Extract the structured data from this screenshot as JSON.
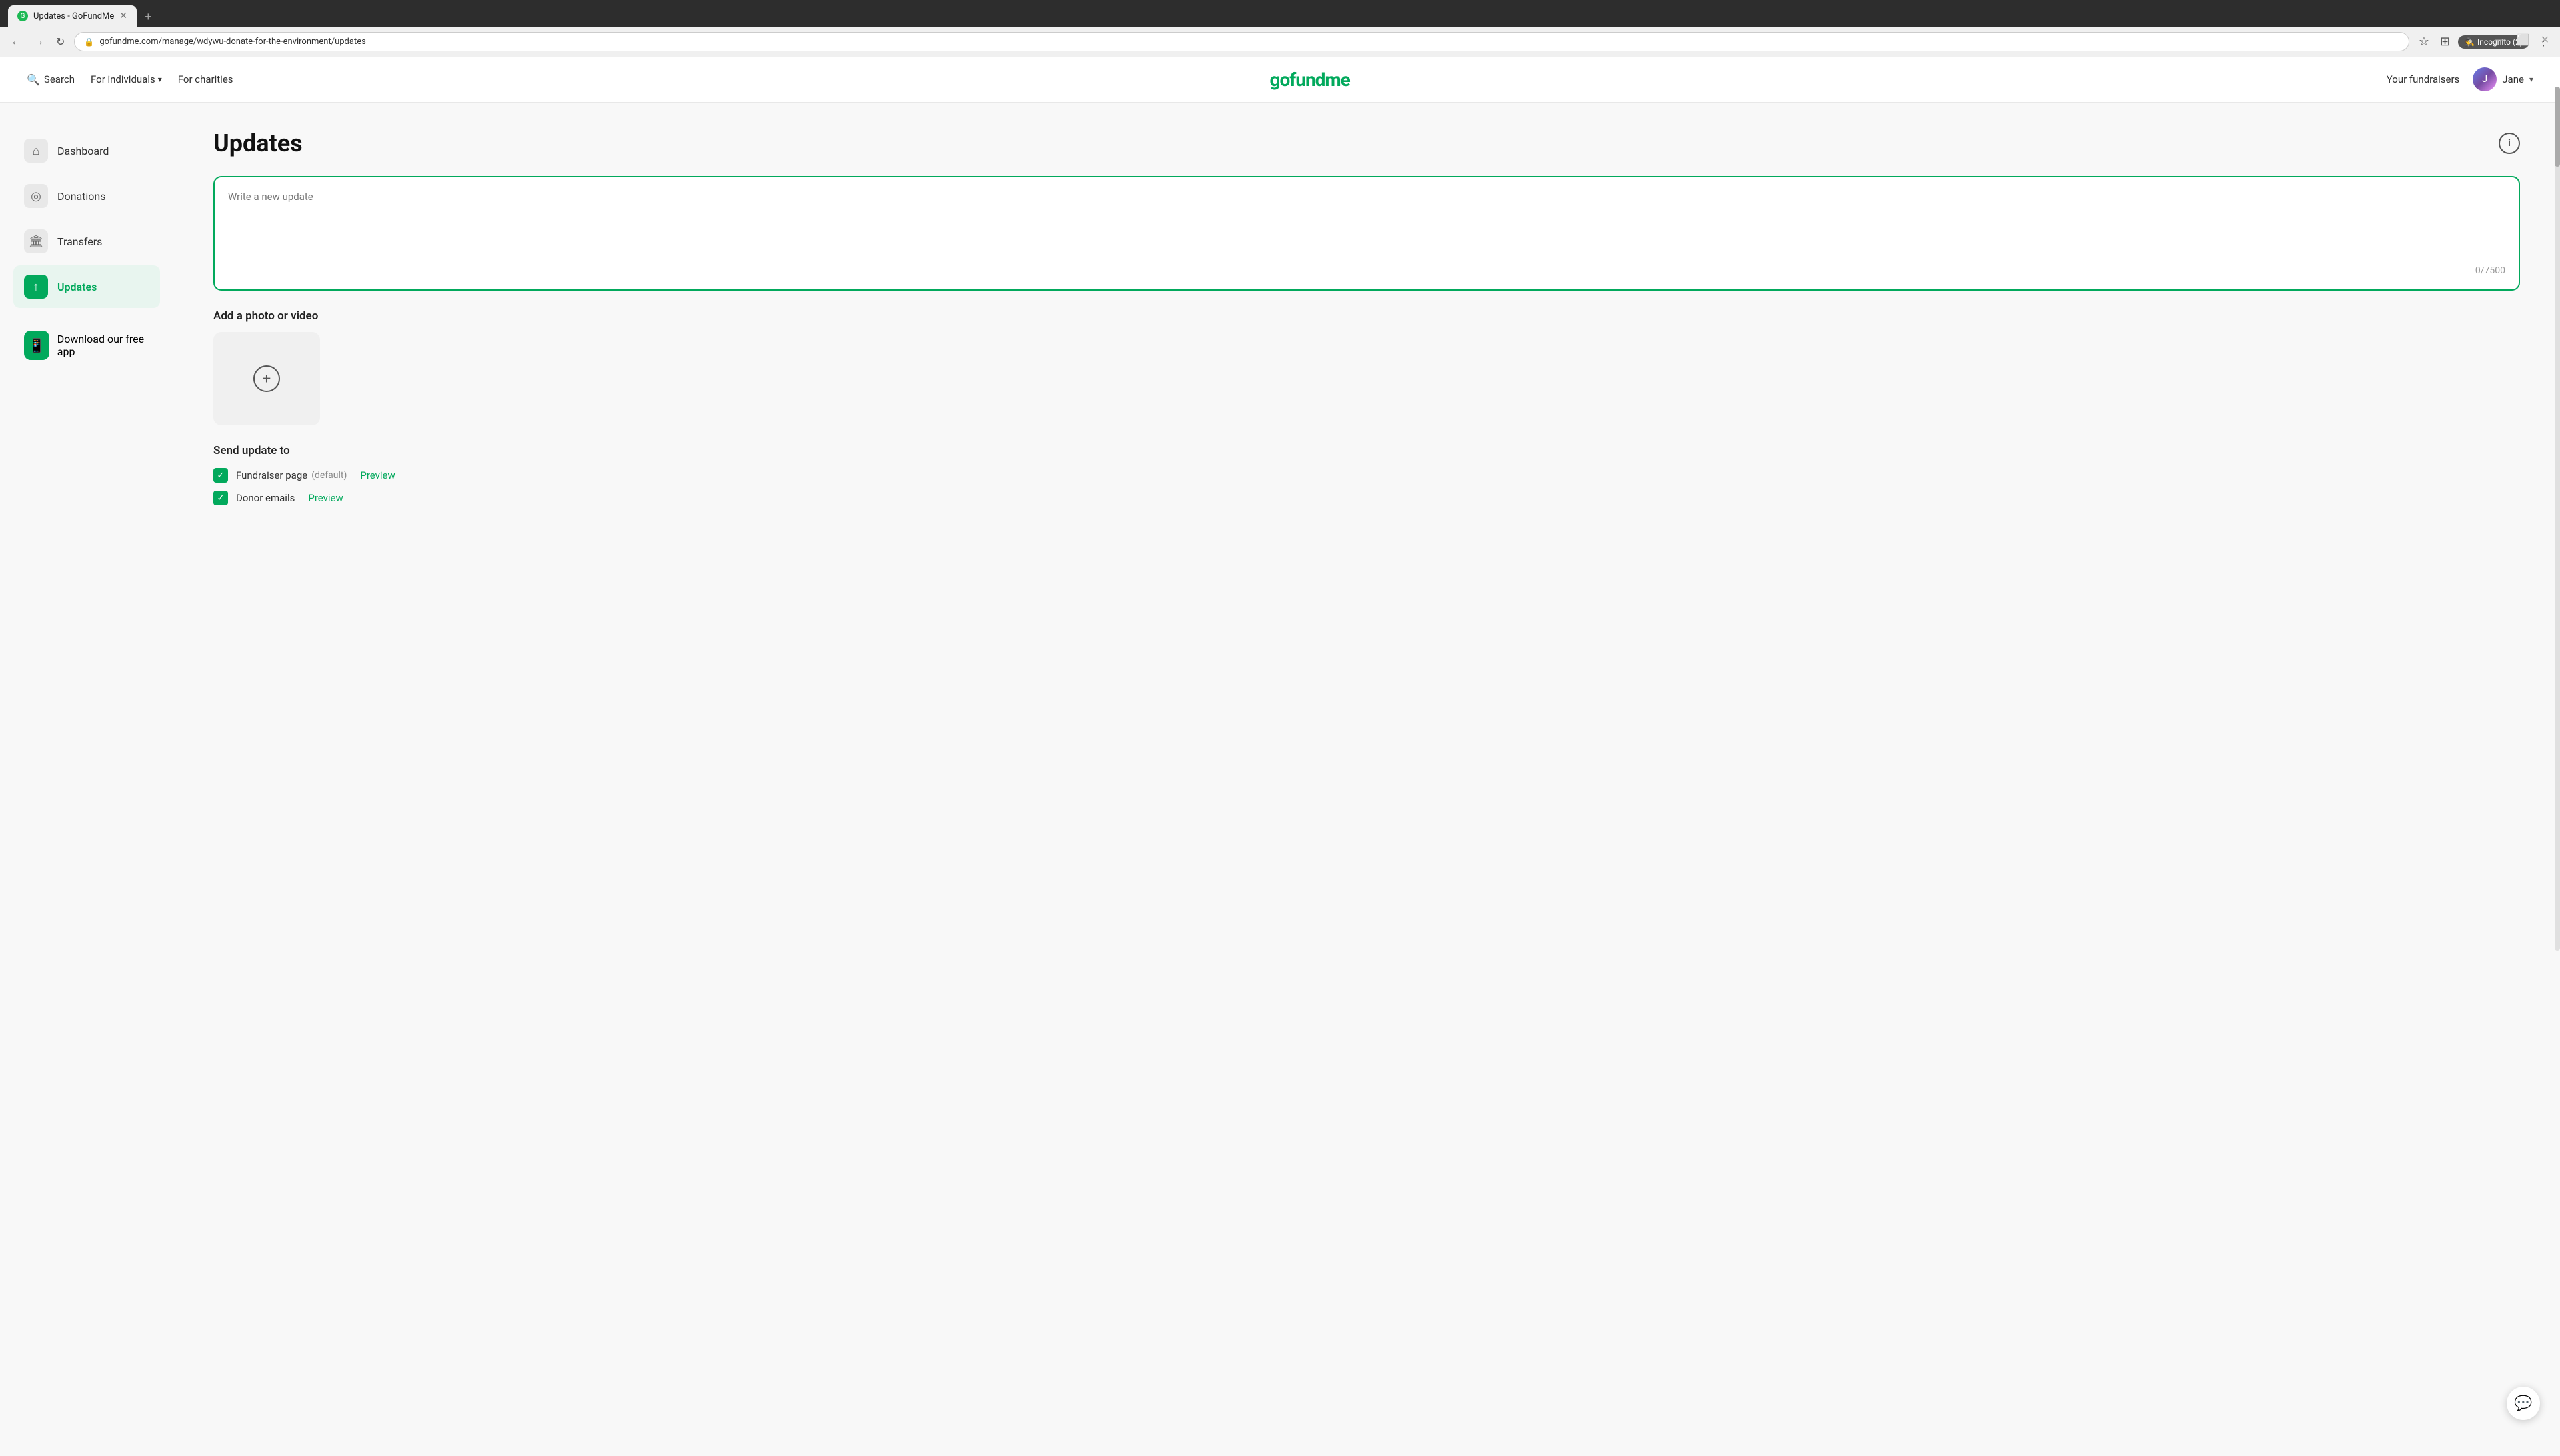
{
  "browser": {
    "tab_title": "Updates - GoFundMe",
    "url": "gofundme.com/manage/wdywu-donate-for-the-environment/updates",
    "new_tab_label": "+",
    "incognito_label": "Incognito (2)"
  },
  "header": {
    "search_label": "Search",
    "for_individuals_label": "For individuals",
    "for_charities_label": "For charities",
    "logo_text": "gofundme",
    "your_fundraisers_label": "Your fundraisers",
    "user_name": "Jane"
  },
  "sidebar": {
    "items": [
      {
        "id": "dashboard",
        "label": "Dashboard",
        "icon": "⌂"
      },
      {
        "id": "donations",
        "label": "Donations",
        "icon": "◎"
      },
      {
        "id": "transfers",
        "label": "Transfers",
        "icon": "🏛"
      },
      {
        "id": "updates",
        "label": "Updates",
        "icon": "↑"
      }
    ],
    "download_app_label": "Download our free app"
  },
  "main": {
    "page_title": "Updates",
    "textarea_placeholder": "Write a new update",
    "char_count": "0/7500",
    "media_section_label": "Add a photo or video",
    "send_update_section": {
      "title": "Send update to",
      "options": [
        {
          "label": "Fundraiser page",
          "default_badge": "(default)",
          "action_label": "Preview",
          "checked": true
        },
        {
          "label": "Donor emails",
          "action_label": "Preview",
          "checked": true
        }
      ]
    }
  },
  "colors": {
    "brand_green": "#02a95c",
    "background": "#f8f8f8"
  }
}
